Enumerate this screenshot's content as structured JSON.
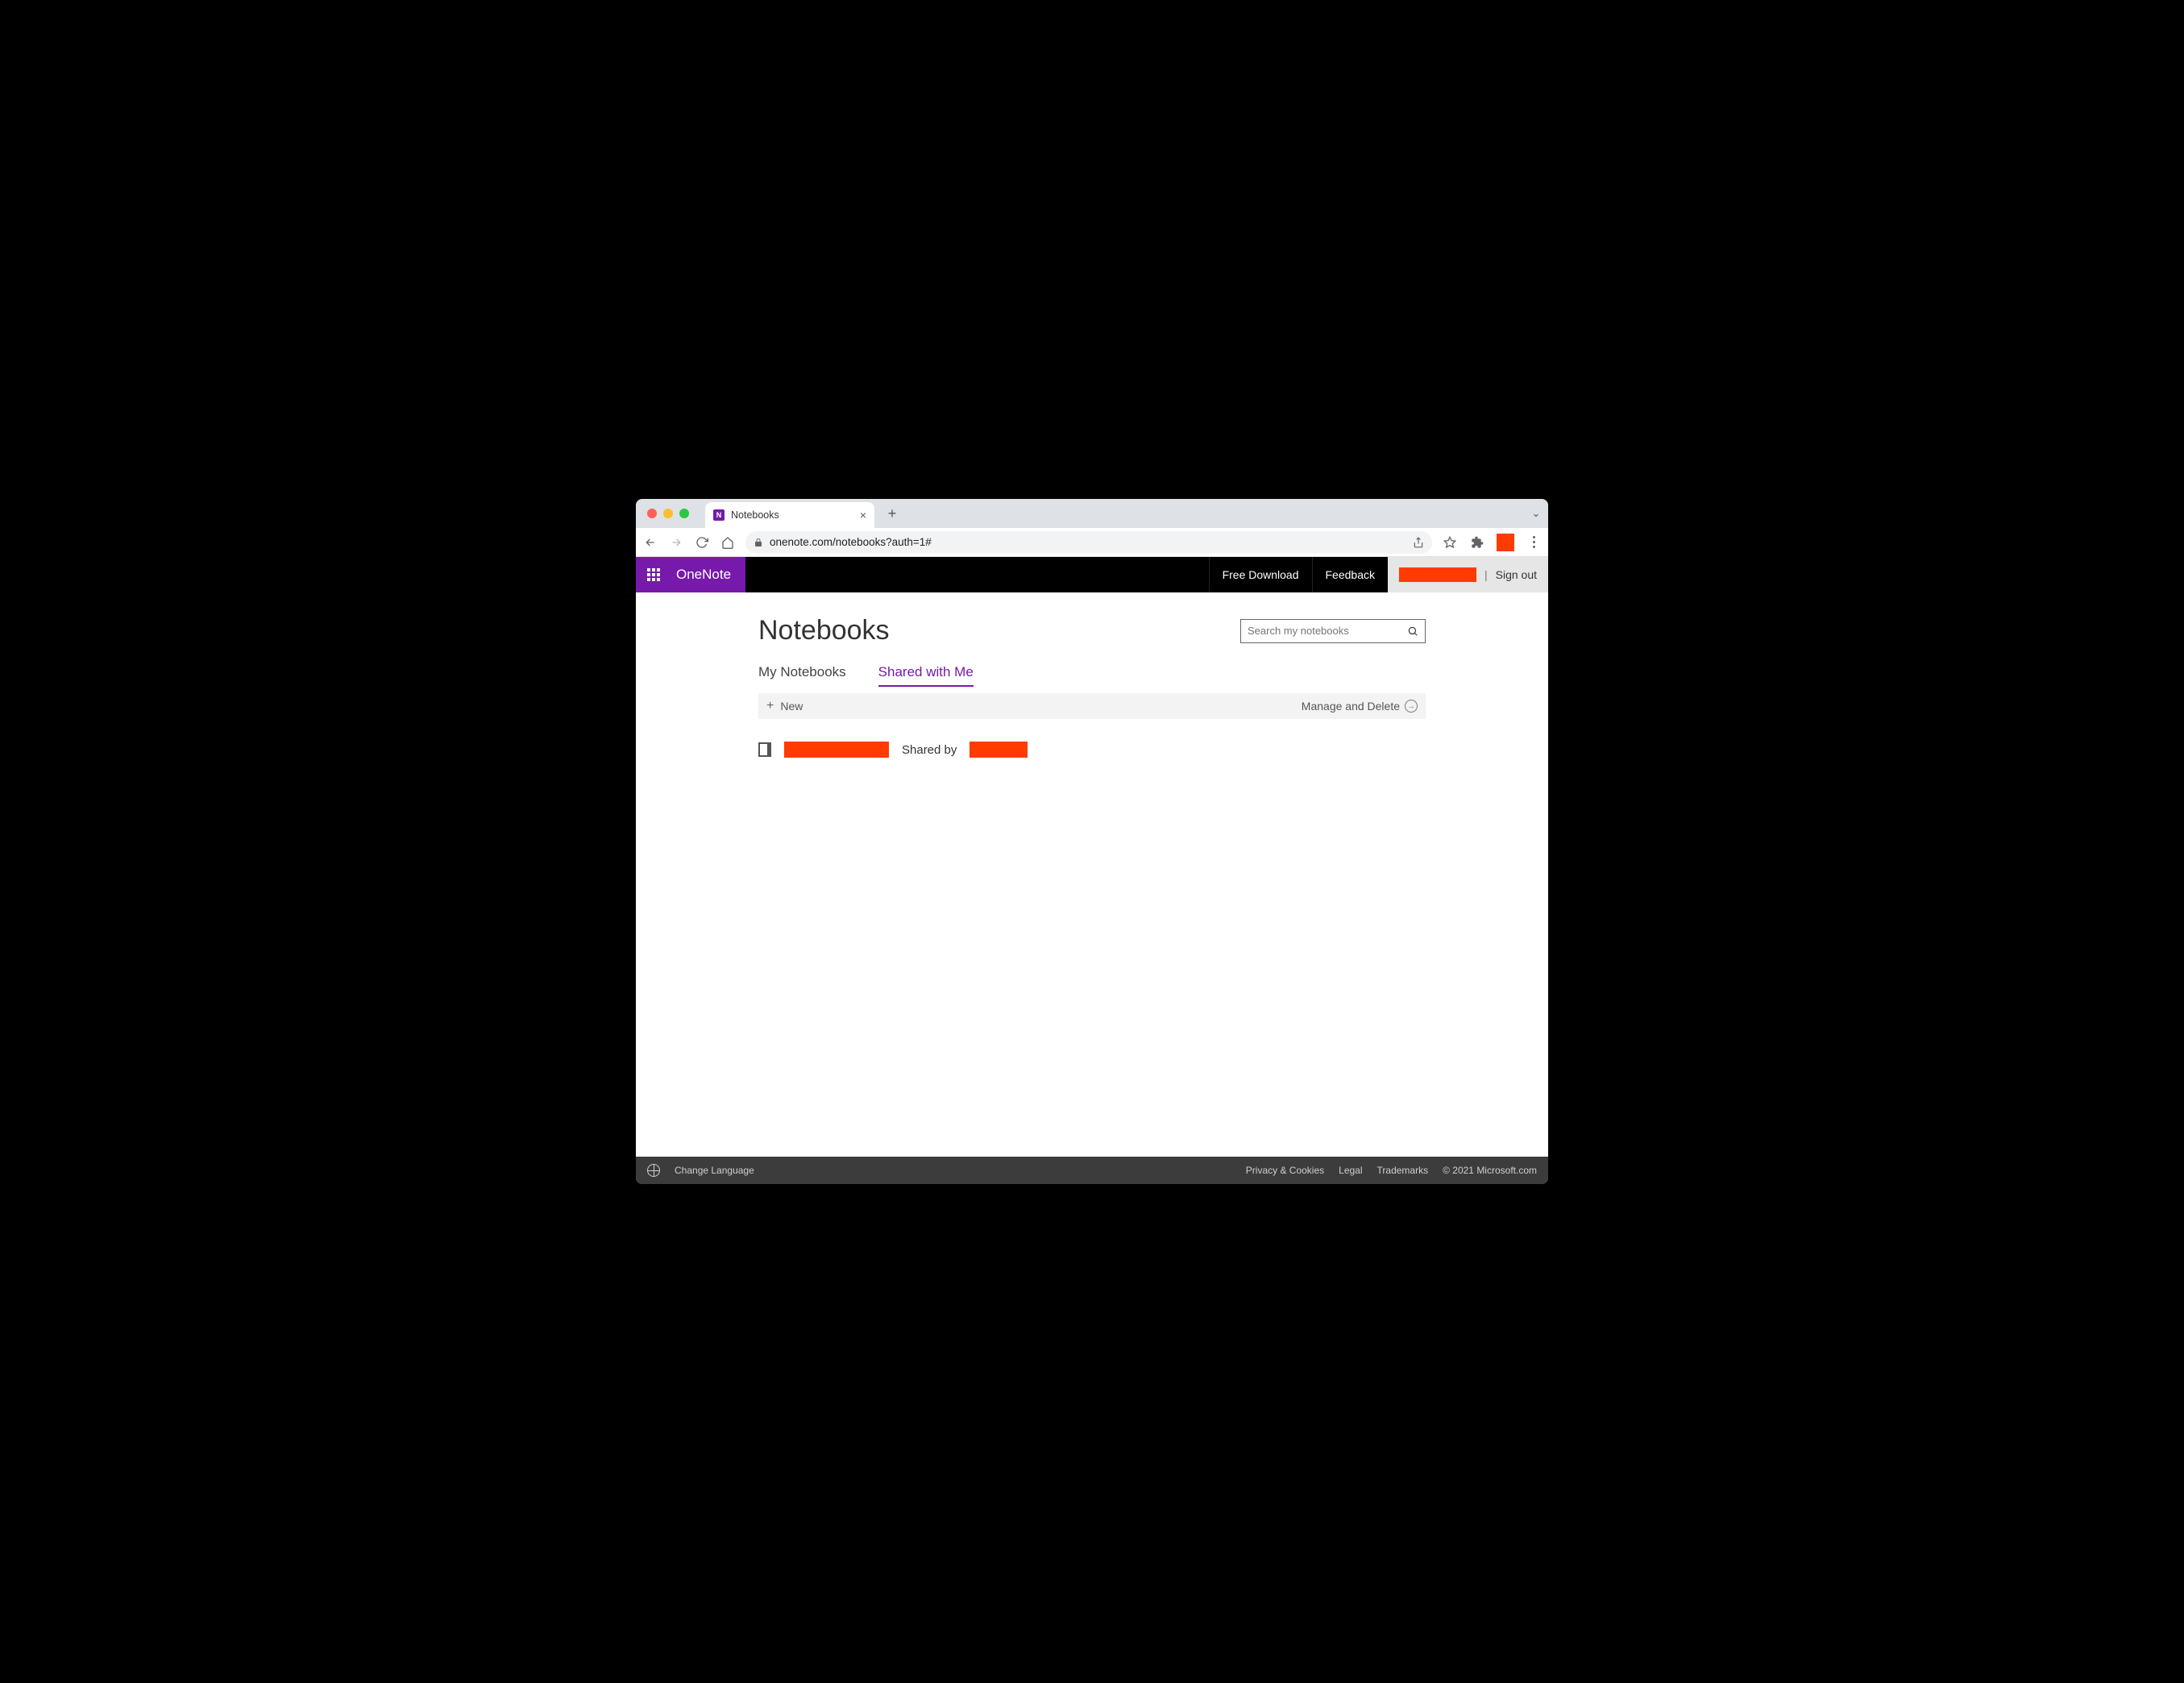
{
  "browser": {
    "tab_title": "Notebooks",
    "url": "onenote.com/notebooks?auth=1#"
  },
  "header": {
    "brand": "OneNote",
    "free_download": "Free Download",
    "feedback": "Feedback",
    "sign_out": "Sign out"
  },
  "page": {
    "title": "Notebooks",
    "search_placeholder": "Search my notebooks",
    "tabs": {
      "my": "My Notebooks",
      "shared": "Shared with Me"
    },
    "toolbar": {
      "new": "New",
      "manage": "Manage and Delete"
    },
    "notebook": {
      "shared_by_label": "Shared by"
    }
  },
  "footer": {
    "change_language": "Change Language",
    "privacy": "Privacy & Cookies",
    "legal": "Legal",
    "trademarks": "Trademarks",
    "copyright": "© 2021 Microsoft.com"
  }
}
